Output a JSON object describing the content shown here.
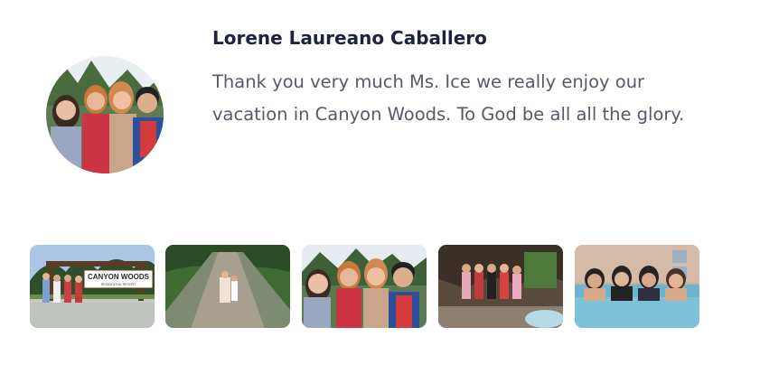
{
  "testimonial": {
    "author": "Lorene Laureano Caballero",
    "text": "Thank you very much Ms. Ice we really enjoy our vacation in Canyon Woods. To God be all all the glory."
  },
  "gallery": {
    "sign_text": "CANYON WOODS",
    "sign_subtext": "RESIDENTIAL RESORT"
  }
}
